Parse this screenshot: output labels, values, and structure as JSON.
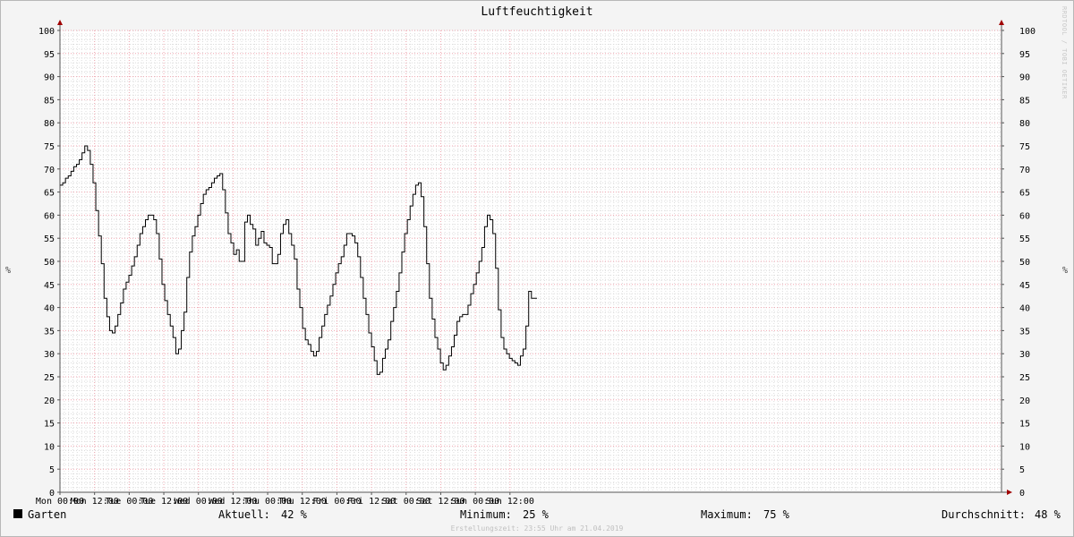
{
  "chart_data": {
    "type": "line",
    "title": "Luftfeuchtigkeit",
    "ylabel": "%",
    "ylim": [
      0,
      100
    ],
    "yticks": [
      0,
      5,
      10,
      15,
      20,
      25,
      30,
      35,
      40,
      45,
      50,
      55,
      60,
      65,
      70,
      75,
      80,
      85,
      90,
      95,
      100
    ],
    "xlim": [
      0,
      13.6
    ],
    "x_unit": "day offsets from Mon 00:00",
    "xticks": [
      {
        "x": 0,
        "label": "Mon 00:00"
      },
      {
        "x": 0.5,
        "label": "Mon 12:00"
      },
      {
        "x": 1,
        "label": "Tue 00:00"
      },
      {
        "x": 1.5,
        "label": "Tue 12:00"
      },
      {
        "x": 2,
        "label": "Wed 00:00"
      },
      {
        "x": 2.5,
        "label": "Wed 12:00"
      },
      {
        "x": 3,
        "label": "Thu 00:00"
      },
      {
        "x": 3.5,
        "label": "Thu 12:00"
      },
      {
        "x": 4,
        "label": "Fri 00:00"
      },
      {
        "x": 4.5,
        "label": "Fri 12:00"
      },
      {
        "x": 5,
        "label": "Sat 00:00"
      },
      {
        "x": 5.5,
        "label": "Sat 12:00"
      },
      {
        "x": 6,
        "label": "Sun 00:00"
      },
      {
        "x": 6.5,
        "label": "Sun 12:00"
      }
    ],
    "grid": true,
    "color": "#000000",
    "series": [
      {
        "name": "Garten",
        "values": [
          66.5,
          67,
          68,
          68.5,
          69.5,
          70.5,
          71,
          72,
          73.5,
          75,
          74,
          71,
          67,
          61,
          55.5,
          49.5,
          42,
          38,
          35,
          34.5,
          36,
          38.5,
          41,
          44,
          45.5,
          47,
          49,
          51,
          53.5,
          56,
          57.5,
          59,
          60,
          60,
          59,
          56,
          50.5,
          45,
          41.5,
          38.5,
          36,
          33.5,
          30,
          31,
          35,
          39,
          46.5,
          52,
          55.5,
          57.5,
          60,
          62.5,
          64.5,
          65.5,
          66,
          67,
          68,
          68.5,
          69,
          65.5,
          60.5,
          56,
          54,
          51.5,
          52.5,
          50,
          50,
          58.5,
          60,
          58,
          57,
          53.5,
          55,
          56.5,
          54,
          53.5,
          53,
          49.5,
          49.5,
          51.5,
          56,
          58,
          59,
          56,
          53.5,
          50.5,
          44,
          40,
          35.5,
          33,
          32,
          30.5,
          29.5,
          30.5,
          33.5,
          36,
          38.5,
          40.5,
          42.5,
          45,
          47.5,
          49.5,
          51,
          53.5,
          56,
          56,
          55.5,
          54,
          51,
          46.5,
          42,
          38.5,
          34.5,
          31.5,
          28.5,
          25.5,
          26,
          29,
          31,
          33,
          37,
          40,
          43.5,
          47.5,
          52,
          56,
          59,
          62,
          64.5,
          66.5,
          67,
          64,
          57.5,
          49.5,
          42,
          37.5,
          33.5,
          31,
          28,
          26.5,
          27.5,
          29.5,
          31.5,
          34,
          37,
          38,
          38.5,
          38.5,
          40.5,
          43,
          45,
          47.5,
          50,
          53,
          57.5,
          60,
          59,
          56,
          48.5,
          39.5,
          33.5,
          31,
          30,
          29,
          28.5,
          28,
          27.5,
          29.5,
          31,
          36,
          43.5,
          42,
          42
        ],
        "last_x": 6.85
      }
    ]
  },
  "legend": {
    "series_label": "Garten",
    "current_label": "Aktuell:",
    "current_value": "42 %",
    "min_label": "Minimum:",
    "min_value": "25 %",
    "max_label": "Maximum:",
    "max_value": "75 %",
    "avg_label": "Durchschnitt:",
    "avg_value": "48 %"
  },
  "footer": "Erstellungszeit: 23:55 Uhr am 21.04.2019",
  "watermark": "RRDTOOL / TOBI OETIKER"
}
